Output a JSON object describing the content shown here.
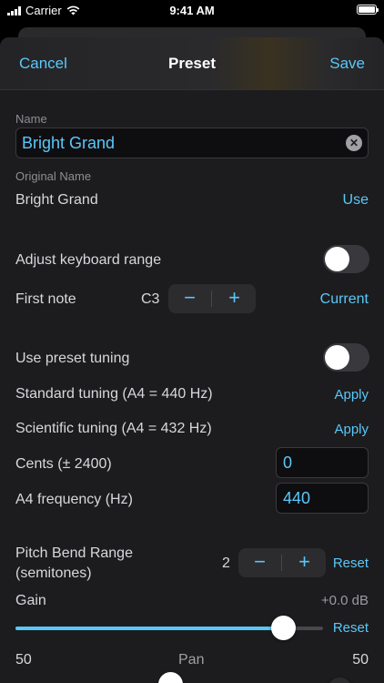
{
  "status_bar": {
    "carrier": "Carrier",
    "time": "9:41 AM"
  },
  "nav": {
    "cancel": "Cancel",
    "title": "Preset",
    "save": "Save"
  },
  "name": {
    "label": "Name",
    "value": "Bright Grand"
  },
  "original_name": {
    "label": "Original Name",
    "value": "Bright Grand",
    "use": "Use"
  },
  "keyboard_range": {
    "label": "Adjust keyboard range",
    "enabled": false
  },
  "first_note": {
    "label": "First note",
    "value": "C3",
    "minus": "−",
    "plus": "+",
    "current": "Current"
  },
  "preset_tuning": {
    "label": "Use preset tuning",
    "enabled": false
  },
  "standard_tuning": {
    "label": "Standard tuning (A4 = 440 Hz)",
    "apply": "Apply"
  },
  "scientific_tuning": {
    "label": "Scientific tuning (A4 = 432 Hz)",
    "apply": "Apply"
  },
  "cents": {
    "label": "Cents (± 2400)",
    "value": "0"
  },
  "a4_frequency": {
    "label": "A4 frequency (Hz)",
    "value": "440"
  },
  "pitch_bend": {
    "label_line1": "Pitch Bend Range",
    "label_line2": "(semitones)",
    "value": "2",
    "minus": "−",
    "plus": "+",
    "reset": "Reset"
  },
  "gain": {
    "label": "Gain",
    "value_text": "+0.0 dB",
    "level": 0.87,
    "reset": "Reset"
  },
  "pan": {
    "label": "Pan",
    "left": "50",
    "right": "50"
  },
  "colors": {
    "accent": "#5ac8fa",
    "background": "#1c1c1e",
    "toggle_off": "#39393d"
  }
}
